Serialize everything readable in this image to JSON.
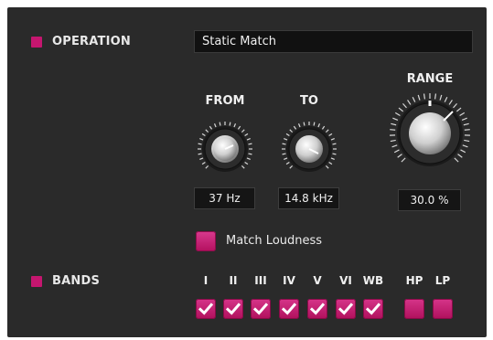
{
  "operation": {
    "label": "OPERATION",
    "mode": "Static Match"
  },
  "knobs": {
    "from": {
      "title": "FROM",
      "value": "37 Hz"
    },
    "to": {
      "title": "TO",
      "value": "14.8 kHz"
    },
    "range": {
      "title": "RANGE",
      "value": "30.0 %"
    }
  },
  "match_loudness": {
    "label": "Match Loudness"
  },
  "bands": {
    "label": "BANDS",
    "items": [
      {
        "label": "I",
        "checked": true
      },
      {
        "label": "II",
        "checked": true
      },
      {
        "label": "III",
        "checked": true
      },
      {
        "label": "IV",
        "checked": true
      },
      {
        "label": "V",
        "checked": true
      },
      {
        "label": "VI",
        "checked": true
      },
      {
        "label": "WB",
        "checked": true
      },
      {
        "label": "HP",
        "checked": false
      },
      {
        "label": "LP",
        "checked": false
      }
    ]
  },
  "colors": {
    "accent": "#c5166f",
    "panel": "#2a2a2a",
    "field": "#151515"
  }
}
